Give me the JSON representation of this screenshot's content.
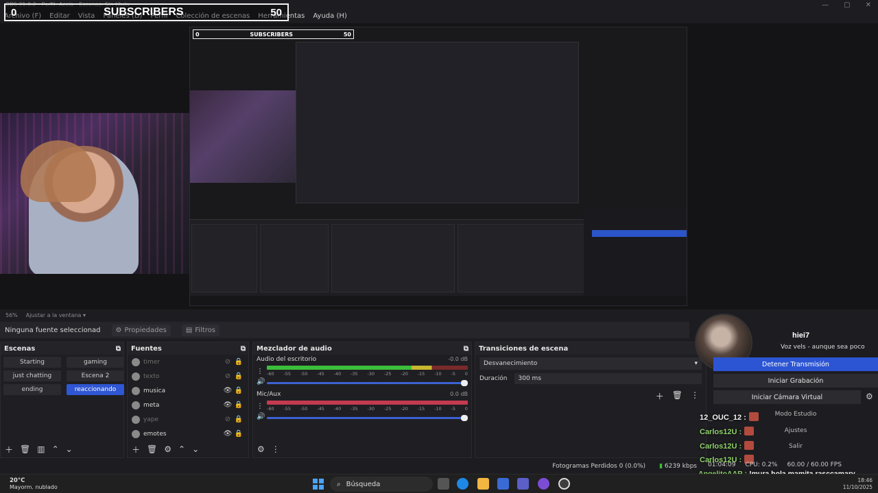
{
  "window": {
    "title": "OBS 31.0.2 - Perfil: Accia - Escenas: Sin título",
    "menu": [
      "Archivo (F)",
      "Editar",
      "Vista",
      "Paneles (D)",
      "Perfil",
      "Colección de escenas",
      "Herramientas",
      "Ayuda (H)"
    ],
    "controls": [
      "—",
      "▢",
      "✕"
    ]
  },
  "overlay": {
    "left_value": "0",
    "label": "SUBSCRIBERS",
    "right_value": "50"
  },
  "nested_preview": {
    "left_value": "0",
    "label": "SUBSCRIBERS",
    "right_value": "50"
  },
  "preview_status": {
    "zoom": "56%",
    "fit": "Ajustar a la ventana"
  },
  "source_toolbar": {
    "no_source": "Ninguna fuente seleccionad",
    "properties": "Propiedades",
    "filters": "Filtros"
  },
  "scenes": {
    "title": "Escenas",
    "items": [
      {
        "label": "Starting",
        "active": false
      },
      {
        "label": "gaming",
        "active": false
      },
      {
        "label": "just chatting",
        "active": false
      },
      {
        "label": "Escena 2",
        "active": false
      },
      {
        "label": "ending",
        "active": false
      },
      {
        "label": "reaccionando",
        "active": true
      }
    ]
  },
  "sources": {
    "title": "Fuentes",
    "items": [
      {
        "label": "timer",
        "visible": false
      },
      {
        "label": "texto",
        "visible": false
      },
      {
        "label": "musica",
        "visible": true
      },
      {
        "label": "meta",
        "visible": true
      },
      {
        "label": "yape",
        "visible": false
      },
      {
        "label": "emotes",
        "visible": true
      }
    ]
  },
  "mixer": {
    "title": "Mezclador de audio",
    "tracks": [
      {
        "name": "Audio del escritorio",
        "db": "-0.0 dB",
        "level_fraction": 0.82
      },
      {
        "name": "Mic/Aux",
        "db": "0.0 dB",
        "level_fraction": 1.0
      }
    ],
    "scale": [
      "-60",
      "-55",
      "-50",
      "-45",
      "-40",
      "-35",
      "-30",
      "-25",
      "-20",
      "-15",
      "-10",
      "-5",
      "0"
    ]
  },
  "transitions": {
    "title": "Transiciones de escena",
    "selected": "Desvanecimiento",
    "duration_label": "Duración",
    "duration_value": "300 ms"
  },
  "controls": {
    "channel_name": "hiei7",
    "channel_subtitle": "Voz vels - aunque sea poco",
    "stop_stream": "Detener Transmisión",
    "start_recording": "Iniciar Grabación",
    "start_vcam": "Iniciar Cámara Virtual",
    "studio_mode": "Modo Estudio",
    "settings": "Ajustes",
    "exit": "Salir"
  },
  "chat": {
    "rows": [
      {
        "user": "12_OUC_12 :",
        "color": "#f2f2f2"
      },
      {
        "user": "Carlos12U :",
        "color": "#8fd16a"
      },
      {
        "user": "Carlos12U :",
        "color": "#8fd16a"
      },
      {
        "user": "Carlos12U :",
        "color": "#8fd16a"
      }
    ],
    "message_user": "AngelitoAAR :",
    "message_text": "!mura hola mamita rasccamary puedes mandarle saludos a la ñaja army?"
  },
  "status": {
    "dropped_frames": "Fotogramas Perdidos 0 (0.0%)",
    "bitrate": "6239 kbps",
    "time": "01:04:09",
    "cpu": "CPU: 0.2%",
    "fps": "60.00 / 60.00 FPS"
  },
  "taskbar": {
    "weather_temp": "20°C",
    "weather_desc": "Mayorm. nublado",
    "search": "Búsqueda",
    "clock_time": "18:46",
    "clock_date": "11/10/2025"
  }
}
